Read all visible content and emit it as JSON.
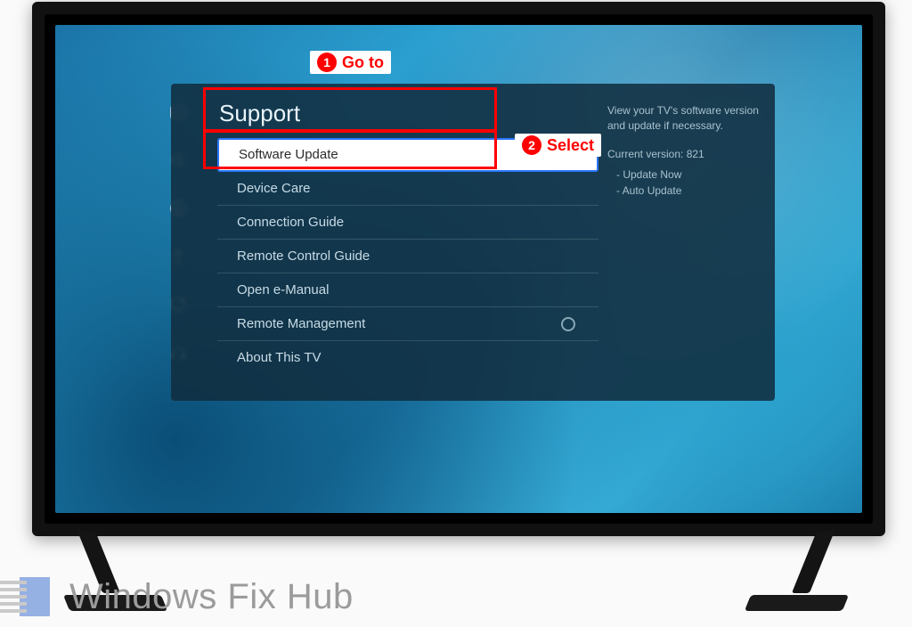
{
  "menu": {
    "title": "Support",
    "items": [
      {
        "label": "Software Update",
        "selected": true
      },
      {
        "label": "Device Care"
      },
      {
        "label": "Connection Guide"
      },
      {
        "label": "Remote Control Guide"
      },
      {
        "label": "Open e-Manual"
      },
      {
        "label": "Remote Management",
        "toggle": true
      },
      {
        "label": "About This TV"
      }
    ]
  },
  "sidebar_icons": [
    "picture-icon",
    "sound-icon",
    "network-icon",
    "accessibility-icon",
    "system-icon",
    "support-icon"
  ],
  "side_panel": {
    "description": "View your TV's software version and update if necessary.",
    "current_version_label": "Current version: 821",
    "options": [
      "Update Now",
      "Auto Update"
    ]
  },
  "annotations": {
    "step1": {
      "num": "1",
      "text": "Go to"
    },
    "step2": {
      "num": "2",
      "text": "Select"
    }
  },
  "watermark": {
    "text": "Windows Fix Hub"
  }
}
